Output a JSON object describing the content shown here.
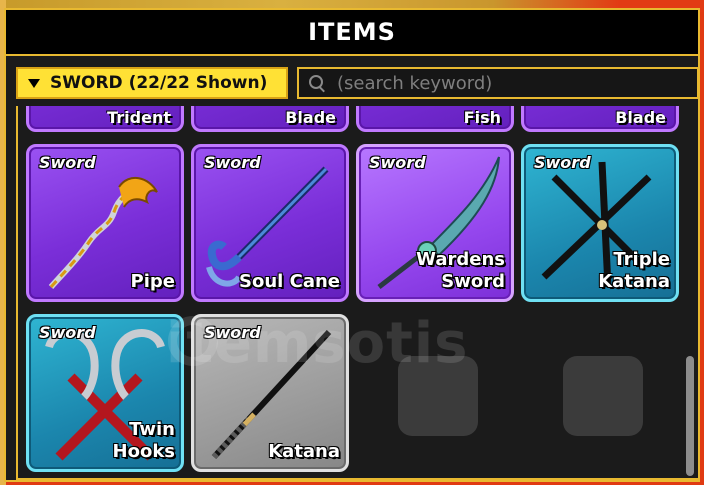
{
  "title": "ITEMS",
  "filter": {
    "label": "SWORD (22/22 Shown)"
  },
  "search": {
    "placeholder": "(search keyword)"
  },
  "partial_row": [
    "Trident",
    "Blade",
    "Fish",
    "Blade"
  ],
  "items": [
    {
      "type": "Sword",
      "name": "Pipe",
      "rarity": "purple"
    },
    {
      "type": "Sword",
      "name": "Soul Cane",
      "rarity": "purple"
    },
    {
      "type": "Sword",
      "name": "Wardens\nSword",
      "rarity": "purple-light"
    },
    {
      "type": "Sword",
      "name": "Triple\nKatana",
      "rarity": "blue"
    },
    {
      "type": "Sword",
      "name": "Twin\nHooks",
      "rarity": "blue"
    },
    {
      "type": "Sword",
      "name": "Katana",
      "rarity": "gray"
    }
  ],
  "watermark": "itemsotis",
  "colors": {
    "panel_border": "#e8b930",
    "filter_bg": "#ffe135",
    "purple": "#7a2ed8",
    "blue": "#1b86ad",
    "gray": "#9b9b9b"
  }
}
